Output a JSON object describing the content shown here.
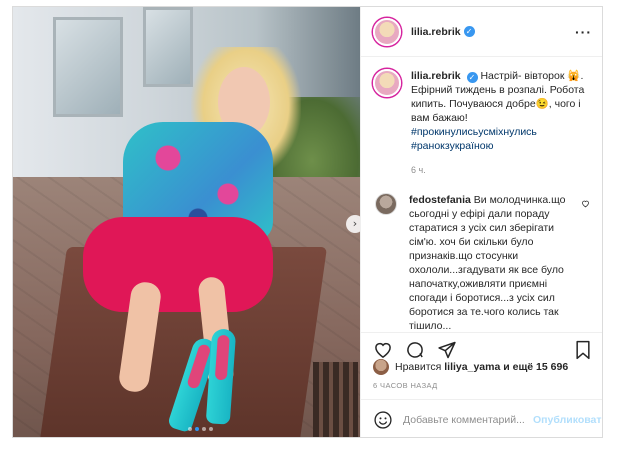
{
  "post": {
    "author": "lilia.rebrik",
    "verified_mark": "✓",
    "more_label": "···",
    "caption": {
      "username": "lilia.rebrik",
      "text": "Настрій- вівторок 🙀. Ефірний тиждень в розпалі. Робота кипить. Почуваюся добре😉, чого і вам бажаю!",
      "hashtags": [
        "#прокинулисьусміхнулись",
        "#ранокзукраїною"
      ],
      "time": "6 ч."
    },
    "comment": {
      "username": "fedostefania",
      "text": "Ви молодчинка.що сьогодні у ефірі дали пораду старатися з усіх сил зберігати сім'ю. хоч би скільки було признаків.що стосунки охололи...згадувати як все було напочатку,оживляти приємні спогади і боротися...з усіх сил боротися за те.чого колись так тішило..."
    },
    "likes": {
      "prefix": "Нравится",
      "user": "liliya_yama",
      "suffix": "и ещё 15 696"
    },
    "time_ago": "6 ЧАСОВ НАЗАД",
    "comment_input_placeholder": "Добавьте комментарий...",
    "publish_label": "Опубликовать",
    "next_arrow": "›",
    "carousel": {
      "count": 4,
      "active_index": 1
    }
  },
  "icons": {
    "like": "heart-icon",
    "comment": "comment-icon",
    "share": "share-icon",
    "save": "bookmark-icon",
    "emoji": "emoji-icon",
    "more": "more-icon",
    "next": "chevron-right-icon"
  },
  "colors": {
    "link": "#00376b",
    "meta": "#8e8e8e",
    "publish_disabled": "#b2dffc",
    "verified": "#3897f0"
  }
}
